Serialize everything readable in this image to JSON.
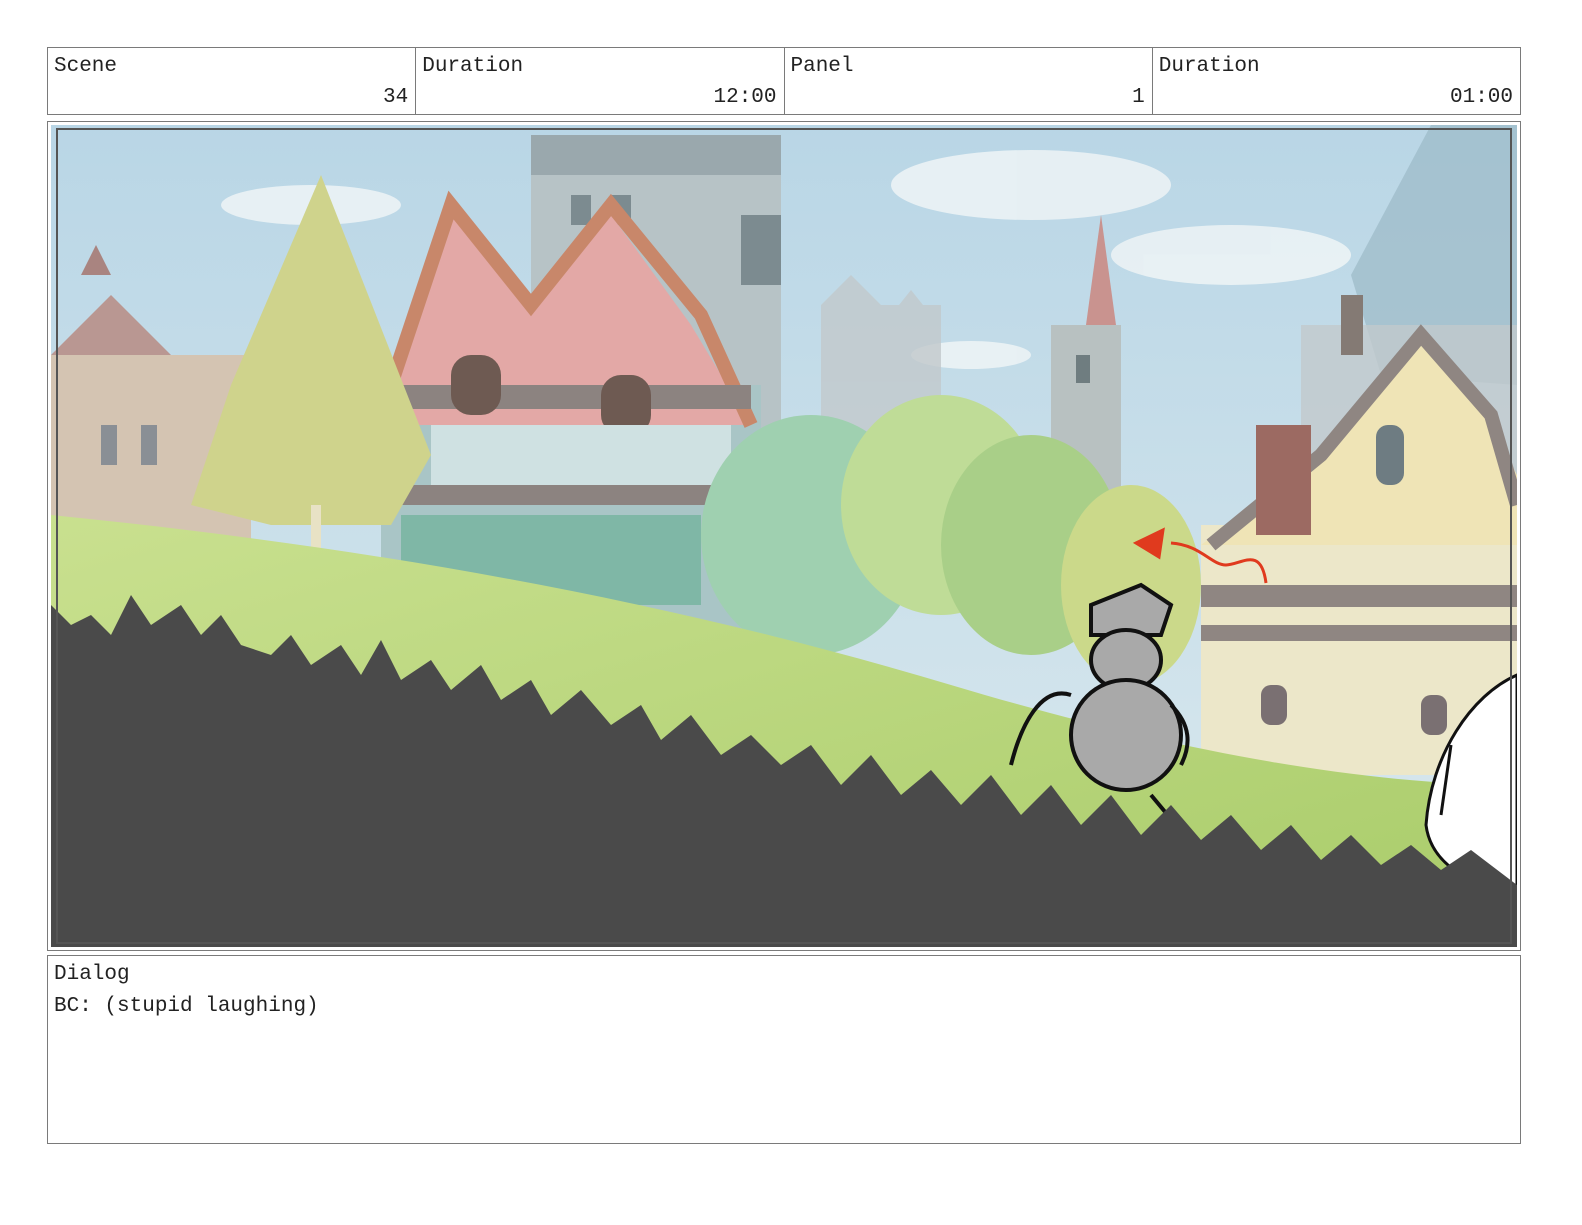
{
  "header": {
    "scene_label": "Scene",
    "scene_value": "34",
    "scene_duration_label": "Duration",
    "scene_duration_value": "12:00",
    "panel_label": "Panel",
    "panel_value": "1",
    "panel_duration_label": "Duration",
    "panel_duration_value": "01:00"
  },
  "dialog": {
    "label": "Dialog",
    "text": "BC: (stupid laughing)"
  }
}
